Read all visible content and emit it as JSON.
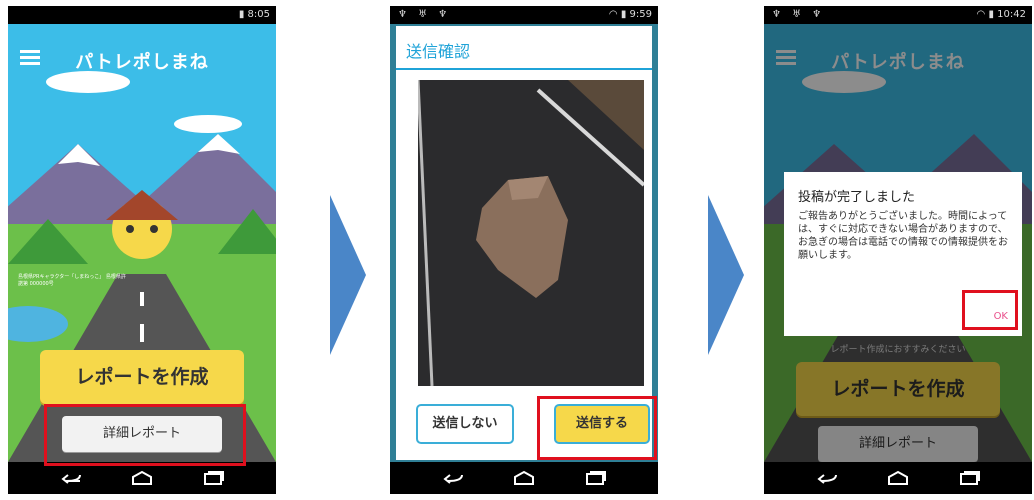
{
  "screen1": {
    "status_time": "8:05",
    "app_title": "パトレポしまね",
    "create_report_label": "レポートを作成",
    "detail_report_label": "詳細レポート",
    "note_text": "島根県PRキャラクター「しまねっこ」 島根県許諾第 000000号"
  },
  "screen2": {
    "status_time": "9:59",
    "dialog_title": "送信確認",
    "dont_send_label": "送信しない",
    "send_label": "送信する"
  },
  "screen3": {
    "status_time": "10:42",
    "app_title": "パトレポしまね",
    "behind_text": "レポート作成におすすみください",
    "create_report_label": "レポートを作成",
    "detail_report_label": "詳細レポート",
    "dialog_title": "投稿が完了しました",
    "dialog_body": "ご報告ありがとうございました。時間によっては、すぐに対応できない場合がありますので、お急ぎの場合は電話での情報での情報提供をお願いします。",
    "ok_label": "OK"
  },
  "colors": {
    "highlight": "#e0101e",
    "arrow": "#4a86c8",
    "accent_yellow": "#f6d84a",
    "accent_blue": "#1fa3d8"
  }
}
